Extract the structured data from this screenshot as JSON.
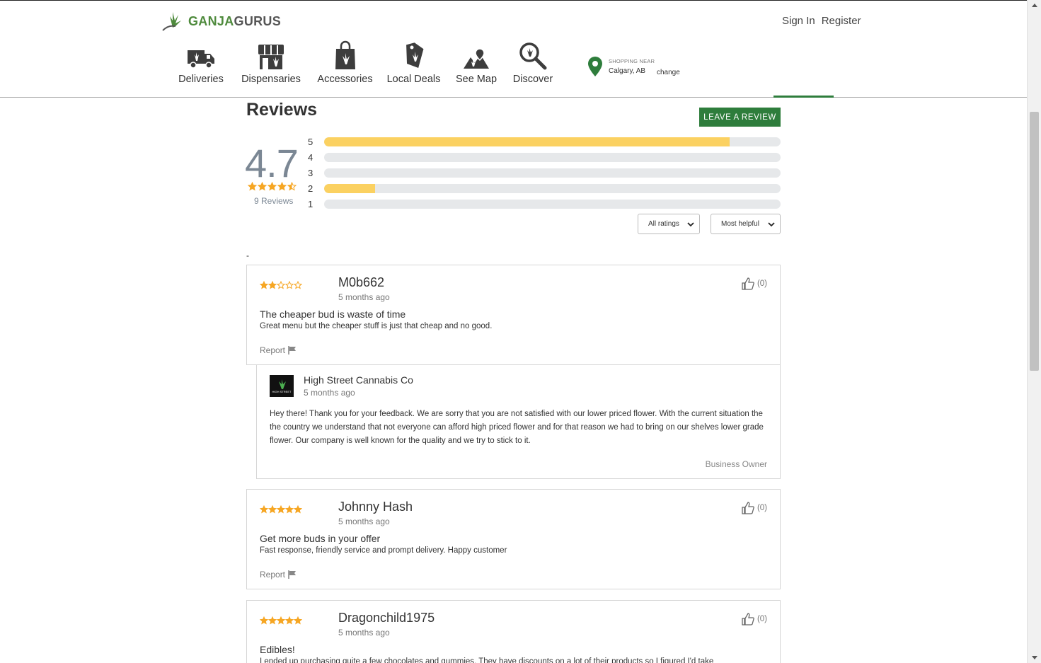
{
  "brand": {
    "logo_text_a": "GANJA",
    "logo_text_b": "GURUS",
    "accent": "#2e7d3c",
    "star_color": "#f6a623",
    "bar_color": "#fbd161"
  },
  "auth": {
    "sign_in": "Sign In",
    "register": "Register"
  },
  "nav": {
    "items": [
      {
        "label": "Deliveries",
        "icon": "delivery-truck-icon"
      },
      {
        "label": "Dispensaries",
        "icon": "storefront-icon"
      },
      {
        "label": "Accessories",
        "icon": "shopping-bag-icon"
      },
      {
        "label": "Local Deals",
        "icon": "price-tag-icon"
      },
      {
        "label": "See Map",
        "icon": "map-icon"
      },
      {
        "label": "Discover",
        "icon": "magnifier-icon"
      }
    ]
  },
  "location": {
    "heading": "SHOPPING NEAR",
    "city": "Calgary, AB",
    "change": "change"
  },
  "reviews": {
    "title": "Reviews",
    "leave_button": "LEAVE A REVIEW",
    "average": "4.7",
    "average_stars": 4.5,
    "count_label": "9 Reviews",
    "distribution": [
      {
        "stars": "5",
        "fraction": 0.889
      },
      {
        "stars": "4",
        "fraction": 0.0
      },
      {
        "stars": "3",
        "fraction": 0.0
      },
      {
        "stars": "2",
        "fraction": 0.111
      },
      {
        "stars": "1",
        "fraction": 0.0
      }
    ],
    "filter_select": "All ratings",
    "sort_select": "Most helpful",
    "dash": "-"
  },
  "review_list": [
    {
      "stars": 2,
      "author": "M0b662",
      "time": "5 months ago",
      "likes": "(0)",
      "title": "The cheaper bud is waste of time",
      "body": "Great menu but the cheaper stuff is just that cheap and no good.",
      "report": "Report"
    },
    {
      "stars": 5,
      "author": "Johnny Hash",
      "time": "5 months ago",
      "likes": "(0)",
      "title": "Get more buds in your offer",
      "body": "Fast response, friendly service and prompt delivery. Happy customer",
      "report": "Report"
    },
    {
      "stars": 5,
      "author": "Dragonchild1975",
      "time": "5 months ago",
      "likes": "(0)",
      "title": "Edibles!",
      "body": "I ended up purchasing quite a few chocolates and gummies. They have discounts on a lot of their products so I figured I'd take"
    }
  ],
  "owner_reply": {
    "avatar_text": "HIGH STREET",
    "business": "High Street Cannabis Co",
    "time": "5 months ago",
    "text": "Hey there! Thank you for your feedback. We are sorry that you are not satisfied with our lower priced flower. With the current situation the the country we understand that not everyone can afford high priced flower and for that reason we had to bring on our shelves lower grade flower. Our company is well known for the quality and we try to stick to it.",
    "role": "Business Owner"
  }
}
